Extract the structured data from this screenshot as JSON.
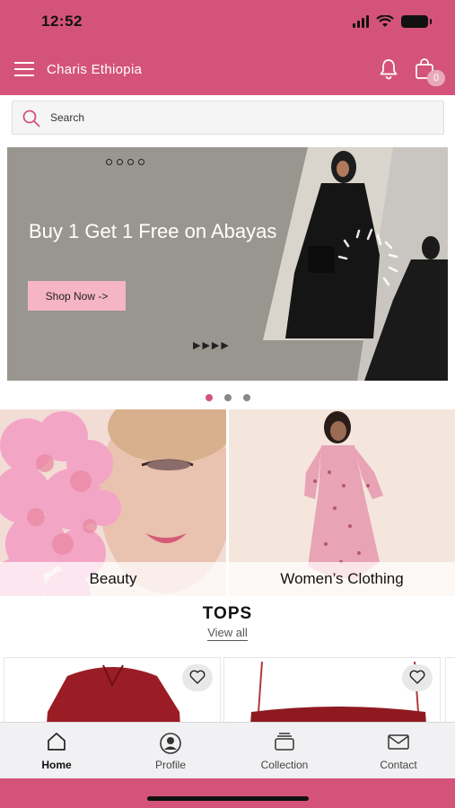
{
  "status_bar": {
    "time": "12:52"
  },
  "header": {
    "title": "Charis Ethiopia",
    "cart_count": "0"
  },
  "search": {
    "placeholder": "Search"
  },
  "banner": {
    "heading": "Buy 1 Get 1 Free on Abayas",
    "cta_label": "Shop Now ->",
    "arrows": "▶▶▶▶"
  },
  "carousel": {
    "page_count": 3,
    "active_index": 0
  },
  "categories": [
    {
      "label": "Beauty"
    },
    {
      "label": "Women’s Clothing"
    }
  ],
  "tops_section": {
    "title": "TOPS",
    "view_all_label": "View all"
  },
  "tab_bar": {
    "tabs": [
      {
        "label": "Home",
        "icon": "home-icon",
        "active": true
      },
      {
        "label": "Profile",
        "icon": "profile-icon",
        "active": false
      },
      {
        "label": "Collection",
        "icon": "collection-icon",
        "active": false
      },
      {
        "label": "Contact",
        "icon": "mail-icon",
        "active": false
      }
    ]
  },
  "colors": {
    "brand_pink": "#d4537b",
    "cta_pink": "#f5b5c5",
    "banner_gray": "#999690"
  }
}
